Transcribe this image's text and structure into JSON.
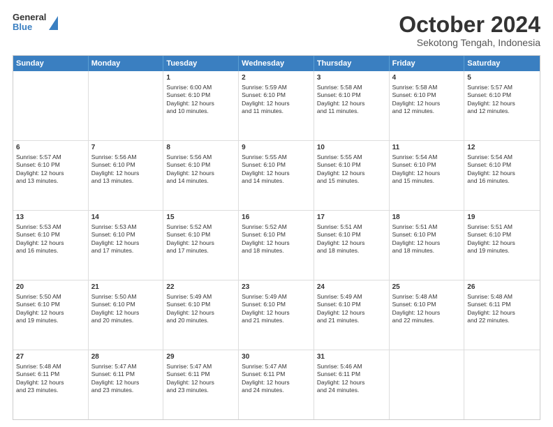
{
  "header": {
    "logo_line1": "General",
    "logo_line2": "Blue",
    "title": "October 2024",
    "subtitle": "Sekotong Tengah, Indonesia"
  },
  "weekdays": [
    "Sunday",
    "Monday",
    "Tuesday",
    "Wednesday",
    "Thursday",
    "Friday",
    "Saturday"
  ],
  "weeks": [
    [
      {
        "day": "",
        "info": ""
      },
      {
        "day": "",
        "info": ""
      },
      {
        "day": "1",
        "info": "Sunrise: 6:00 AM\nSunset: 6:10 PM\nDaylight: 12 hours\nand 10 minutes."
      },
      {
        "day": "2",
        "info": "Sunrise: 5:59 AM\nSunset: 6:10 PM\nDaylight: 12 hours\nand 11 minutes."
      },
      {
        "day": "3",
        "info": "Sunrise: 5:58 AM\nSunset: 6:10 PM\nDaylight: 12 hours\nand 11 minutes."
      },
      {
        "day": "4",
        "info": "Sunrise: 5:58 AM\nSunset: 6:10 PM\nDaylight: 12 hours\nand 12 minutes."
      },
      {
        "day": "5",
        "info": "Sunrise: 5:57 AM\nSunset: 6:10 PM\nDaylight: 12 hours\nand 12 minutes."
      }
    ],
    [
      {
        "day": "6",
        "info": "Sunrise: 5:57 AM\nSunset: 6:10 PM\nDaylight: 12 hours\nand 13 minutes."
      },
      {
        "day": "7",
        "info": "Sunrise: 5:56 AM\nSunset: 6:10 PM\nDaylight: 12 hours\nand 13 minutes."
      },
      {
        "day": "8",
        "info": "Sunrise: 5:56 AM\nSunset: 6:10 PM\nDaylight: 12 hours\nand 14 minutes."
      },
      {
        "day": "9",
        "info": "Sunrise: 5:55 AM\nSunset: 6:10 PM\nDaylight: 12 hours\nand 14 minutes."
      },
      {
        "day": "10",
        "info": "Sunrise: 5:55 AM\nSunset: 6:10 PM\nDaylight: 12 hours\nand 15 minutes."
      },
      {
        "day": "11",
        "info": "Sunrise: 5:54 AM\nSunset: 6:10 PM\nDaylight: 12 hours\nand 15 minutes."
      },
      {
        "day": "12",
        "info": "Sunrise: 5:54 AM\nSunset: 6:10 PM\nDaylight: 12 hours\nand 16 minutes."
      }
    ],
    [
      {
        "day": "13",
        "info": "Sunrise: 5:53 AM\nSunset: 6:10 PM\nDaylight: 12 hours\nand 16 minutes."
      },
      {
        "day": "14",
        "info": "Sunrise: 5:53 AM\nSunset: 6:10 PM\nDaylight: 12 hours\nand 17 minutes."
      },
      {
        "day": "15",
        "info": "Sunrise: 5:52 AM\nSunset: 6:10 PM\nDaylight: 12 hours\nand 17 minutes."
      },
      {
        "day": "16",
        "info": "Sunrise: 5:52 AM\nSunset: 6:10 PM\nDaylight: 12 hours\nand 18 minutes."
      },
      {
        "day": "17",
        "info": "Sunrise: 5:51 AM\nSunset: 6:10 PM\nDaylight: 12 hours\nand 18 minutes."
      },
      {
        "day": "18",
        "info": "Sunrise: 5:51 AM\nSunset: 6:10 PM\nDaylight: 12 hours\nand 18 minutes."
      },
      {
        "day": "19",
        "info": "Sunrise: 5:51 AM\nSunset: 6:10 PM\nDaylight: 12 hours\nand 19 minutes."
      }
    ],
    [
      {
        "day": "20",
        "info": "Sunrise: 5:50 AM\nSunset: 6:10 PM\nDaylight: 12 hours\nand 19 minutes."
      },
      {
        "day": "21",
        "info": "Sunrise: 5:50 AM\nSunset: 6:10 PM\nDaylight: 12 hours\nand 20 minutes."
      },
      {
        "day": "22",
        "info": "Sunrise: 5:49 AM\nSunset: 6:10 PM\nDaylight: 12 hours\nand 20 minutes."
      },
      {
        "day": "23",
        "info": "Sunrise: 5:49 AM\nSunset: 6:10 PM\nDaylight: 12 hours\nand 21 minutes."
      },
      {
        "day": "24",
        "info": "Sunrise: 5:49 AM\nSunset: 6:10 PM\nDaylight: 12 hours\nand 21 minutes."
      },
      {
        "day": "25",
        "info": "Sunrise: 5:48 AM\nSunset: 6:10 PM\nDaylight: 12 hours\nand 22 minutes."
      },
      {
        "day": "26",
        "info": "Sunrise: 5:48 AM\nSunset: 6:11 PM\nDaylight: 12 hours\nand 22 minutes."
      }
    ],
    [
      {
        "day": "27",
        "info": "Sunrise: 5:48 AM\nSunset: 6:11 PM\nDaylight: 12 hours\nand 23 minutes."
      },
      {
        "day": "28",
        "info": "Sunrise: 5:47 AM\nSunset: 6:11 PM\nDaylight: 12 hours\nand 23 minutes."
      },
      {
        "day": "29",
        "info": "Sunrise: 5:47 AM\nSunset: 6:11 PM\nDaylight: 12 hours\nand 23 minutes."
      },
      {
        "day": "30",
        "info": "Sunrise: 5:47 AM\nSunset: 6:11 PM\nDaylight: 12 hours\nand 24 minutes."
      },
      {
        "day": "31",
        "info": "Sunrise: 5:46 AM\nSunset: 6:11 PM\nDaylight: 12 hours\nand 24 minutes."
      },
      {
        "day": "",
        "info": ""
      },
      {
        "day": "",
        "info": ""
      }
    ]
  ]
}
